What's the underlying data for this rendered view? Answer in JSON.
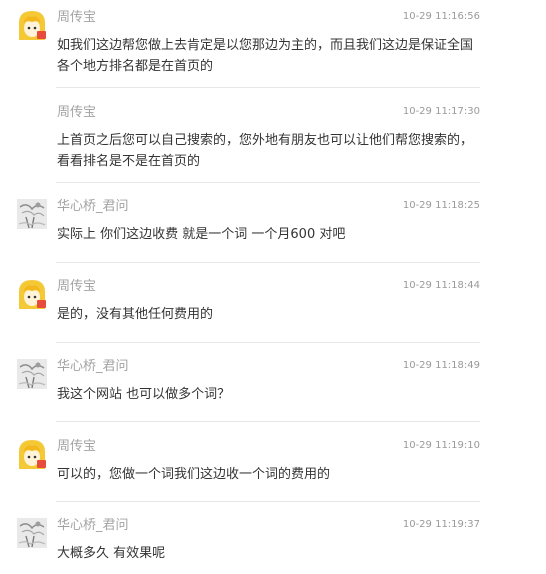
{
  "messages": [
    {
      "sender": "周传宝",
      "time": "10-29 11:16:56",
      "avatar": "yellow-hair-avatar-icon",
      "text": "如我们这边帮您做上去肯定是以您那边为主的，而且我们这边是保证全国各个地方排名都是在首页的"
    },
    {
      "sender": "周传宝",
      "time": "10-29 11:17:30",
      "avatar": "",
      "text": "上首页之后您可以自己搜索的，您外地有朋友也可以让他们帮您搜索的，看看排名是不是在首页的"
    },
    {
      "sender": "华心桥_君问",
      "time": "10-29 11:18:25",
      "avatar": "grey-sketch-avatar-icon",
      "text": "实际上 你们这边收费 就是一个词 一个月600 对吧"
    },
    {
      "sender": "周传宝",
      "time": "10-29 11:18:44",
      "avatar": "yellow-hair-avatar-icon",
      "text": "是的，没有其他任何费用的"
    },
    {
      "sender": "华心桥_君问",
      "time": "10-29 11:18:49",
      "avatar": "grey-sketch-avatar-icon",
      "text": "我这个网站 也可以做多个词？"
    },
    {
      "sender": "周传宝",
      "time": "10-29 11:19:10",
      "avatar": "yellow-hair-avatar-icon",
      "text": "可以的，您做一个词我们这边收一个词的费用的"
    },
    {
      "sender": "华心桥_君问",
      "time": "10-29 11:19:37",
      "avatar": "grey-sketch-avatar-icon",
      "text": "大概多久 有效果呢"
    }
  ],
  "colors": {
    "sender": "#a3a3a3",
    "time": "#9a9a9a",
    "text": "#333333",
    "divider": "#e6e6e6",
    "avatar_hair": "#f5c836",
    "avatar_badge": "#e84a3c"
  }
}
